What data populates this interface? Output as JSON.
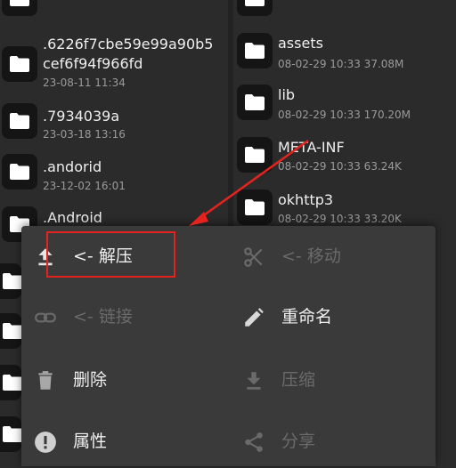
{
  "left_files": [
    {
      "name": ""
    },
    {
      "name_line1": ".6226f7cbe59e99a90b5",
      "name_line2": "cef6f94f966fd",
      "meta": "23-08-11 11:34"
    },
    {
      "name": ".7934039a",
      "meta": "23-03-18 13:16"
    },
    {
      "name": ".andorid",
      "meta": "23-12-02 16:01"
    },
    {
      "name": ".Android",
      "meta": ""
    }
  ],
  "right_files": [
    {
      "name": ""
    },
    {
      "name": "assets",
      "meta": "08-02-29 10:33  37.08M"
    },
    {
      "name": "lib",
      "meta": "08-02-29 10:33  170.20M"
    },
    {
      "name": "META-INF",
      "meta": "08-02-29 10:33  63.24K"
    },
    {
      "name": "okhttp3",
      "meta": "08-02-29 10:33  33.20K"
    }
  ],
  "menu": {
    "extract": "<- 解压",
    "move": "<- 移动",
    "link": "<- 链接",
    "rename": "重命名",
    "delete": "删除",
    "compress": "压缩",
    "properties": "属性",
    "share": "分享"
  },
  "colors": {
    "annotation": "#e5231e",
    "menu_bg": "#3a3a3a",
    "background": "#2b2b2b"
  }
}
